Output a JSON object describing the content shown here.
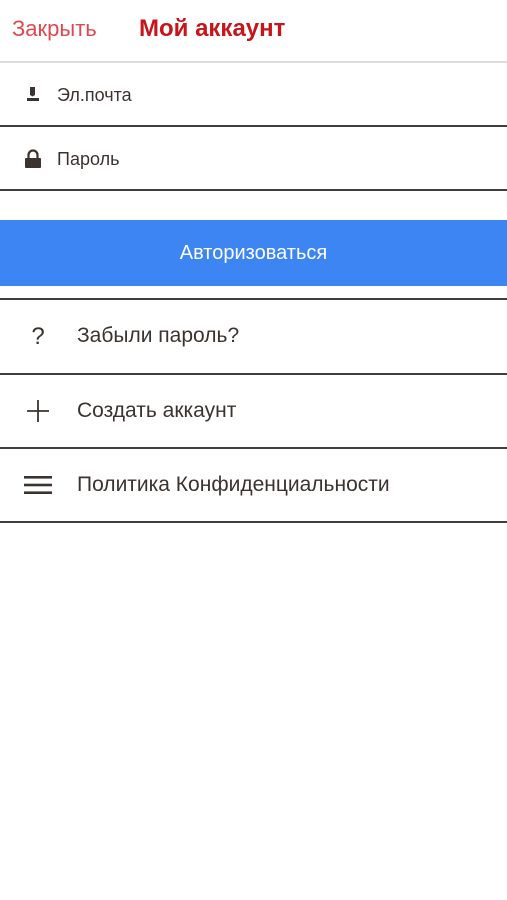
{
  "header": {
    "close_label": "Закрыть",
    "title": "Мой аккаунт"
  },
  "form": {
    "email_placeholder": "Эл.почта",
    "password_placeholder": "Пароль",
    "email_icon": "user-icon",
    "password_icon": "lock-icon",
    "submit_label": "Авторизоваться"
  },
  "menu": {
    "items": [
      {
        "label": "Забыли пароль?",
        "icon": "question-icon"
      },
      {
        "label": "Создать аккаунт",
        "icon": "plus-icon"
      },
      {
        "label": "Политика Конфиденциальности",
        "icon": "menu-lines-icon"
      }
    ]
  },
  "colors": {
    "close_link": "#e0484f",
    "title": "#c8141b",
    "button_bg": "#3d85f2",
    "text": "#3a3330"
  }
}
